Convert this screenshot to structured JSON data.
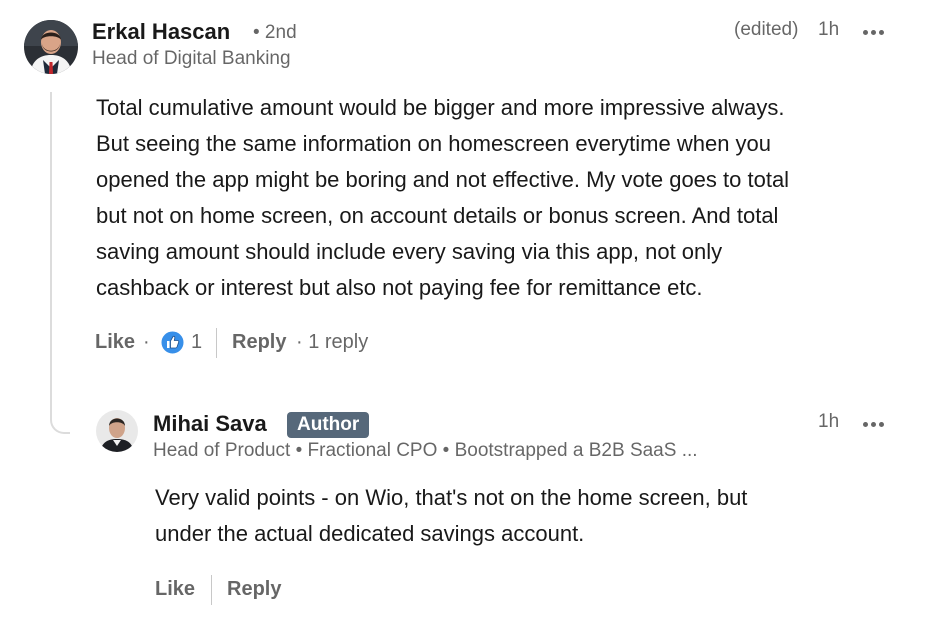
{
  "comment": {
    "author_name": "Erkal Hascan",
    "degree": "• 2nd",
    "headline": "Head of Digital Banking",
    "edited": "(edited)",
    "time": "1h",
    "body_lines": [
      "Total cumulative amount would be bigger and more impressive always.",
      "But seeing the same information on homescreen everytime when you",
      "opened the app might be boring and not effective. My vote goes to total",
      "but not on home screen, on account details or bonus screen. And total",
      "saving amount should include every saving via this app, not only",
      "cashback or interest but also not paying fee for remittance etc."
    ],
    "like_label": "Like",
    "dot": "·",
    "reaction_count": "1",
    "reply_label": "Reply",
    "replies": "· 1 reply",
    "reaction_icon": "like-reaction-icon",
    "colors": {
      "reaction_blue": "#378fe9"
    }
  },
  "reply": {
    "author_name": "Mihai Sava",
    "badge": "Author",
    "headline": "Head of Product • Fractional CPO • Bootstrapped a B2B SaaS ...",
    "time": "1h",
    "body_lines": [
      "Very valid points - on Wio, that's not on the home screen, but",
      "under the actual dedicated savings account."
    ],
    "like_label": "Like",
    "reply_label": "Reply",
    "colors": {
      "badge_bg": "#56687a"
    }
  }
}
